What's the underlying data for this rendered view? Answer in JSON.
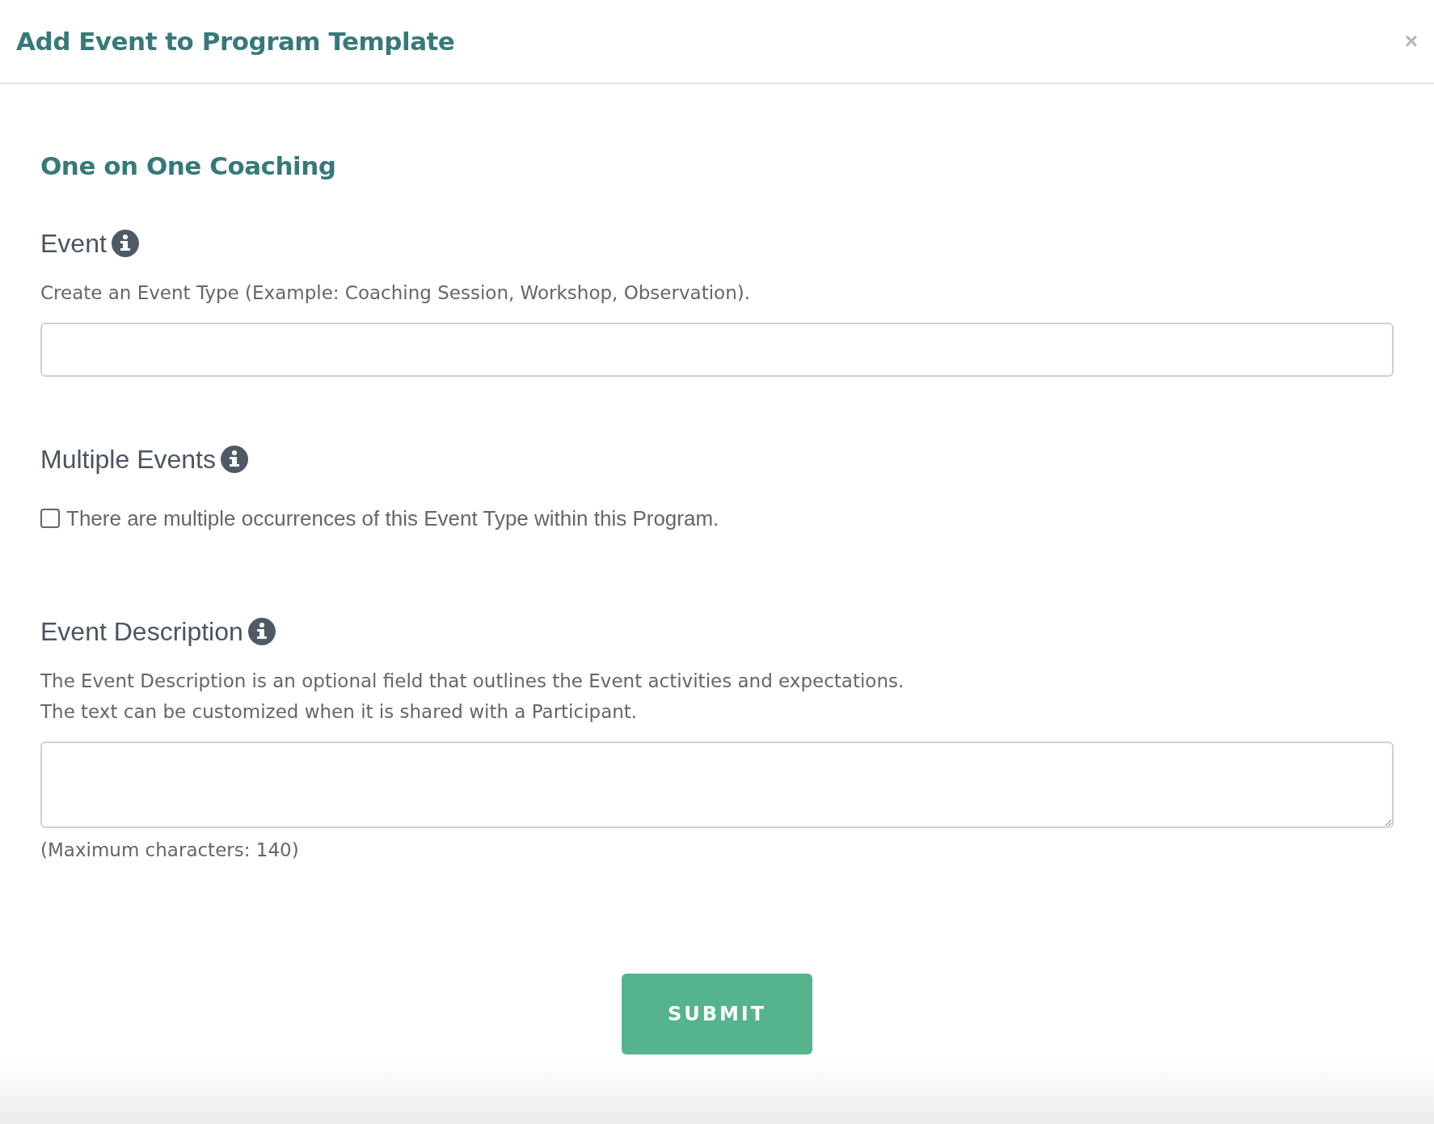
{
  "dialog": {
    "title": "Add Event to Program Template",
    "close": "×"
  },
  "section_title": "One on One Coaching",
  "fields": [
    {
      "kind": "text",
      "label": "Event",
      "help": [
        "Create an Event Type (Example: Coaching Session, Workshop, Observation)."
      ]
    },
    {
      "kind": "checkbox",
      "label": "Multiple Events",
      "checkbox": {
        "label": "There are multiple occurrences of this Event Type within this Program.",
        "checked": false
      }
    },
    {
      "kind": "textarea",
      "label": "Event Description",
      "help": [
        "The Event Description is an optional field that outlines the Event activities and expectations.",
        "The text can be customized when it is shared with a Participant."
      ],
      "note": "(Maximum characters: 140)"
    }
  ],
  "submit": "SUBMIT"
}
